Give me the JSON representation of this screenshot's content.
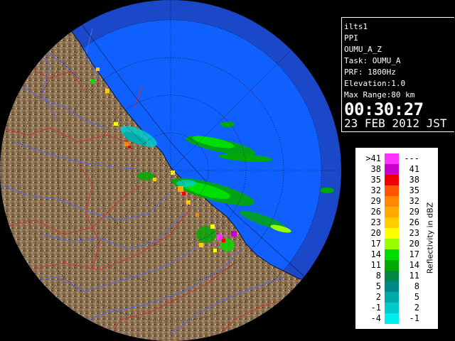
{
  "info_panel": {
    "radar_id": "ilts1",
    "scan_type": "PPI",
    "product": "OUMU_A_Z",
    "task": "Task: OUMU_A",
    "prf": "PRF: 1800Hz",
    "elevation": "Elevation:1.0",
    "max_range": "Max Range:80 km",
    "time": "00:30:27",
    "date": "23 FEB 2012 JST"
  },
  "legend": {
    "caption": "Reflectivity in dBZ",
    "rows": [
      {
        "low": ">41",
        "high": "---",
        "color": "#ff33ff"
      },
      {
        "low": "38",
        "high": "41",
        "color": "#cc00cc"
      },
      {
        "low": "35",
        "high": "38",
        "color": "#ee0000"
      },
      {
        "low": "32",
        "high": "35",
        "color": "#ff5500"
      },
      {
        "low": "29",
        "high": "32",
        "color": "#ff8800"
      },
      {
        "low": "26",
        "high": "29",
        "color": "#ffaa00"
      },
      {
        "low": "23",
        "high": "26",
        "color": "#ffcc00"
      },
      {
        "low": "20",
        "high": "23",
        "color": "#ffff00"
      },
      {
        "low": "17",
        "high": "20",
        "color": "#99ff00"
      },
      {
        "low": "14",
        "high": "17",
        "color": "#00dd00"
      },
      {
        "low": "11",
        "high": "14",
        "color": "#00aa00"
      },
      {
        "low": "8",
        "high": "11",
        "color": "#008844"
      },
      {
        "low": "5",
        "high": "8",
        "color": "#008888"
      },
      {
        "low": "2",
        "high": "5",
        "color": "#00aaaa"
      },
      {
        "low": "-1",
        "high": "2",
        "color": "#00cccc"
      },
      {
        "low": "-4",
        "high": "-1",
        "color": "#00eeee"
      }
    ]
  },
  "map": {
    "ocean_color": "#1060ff",
    "outer_color": "#1a48c8",
    "land_color": "#8a7050",
    "river_color": "#5566ee",
    "boundary_color": "#cc3333",
    "ring_color": "#000000"
  }
}
